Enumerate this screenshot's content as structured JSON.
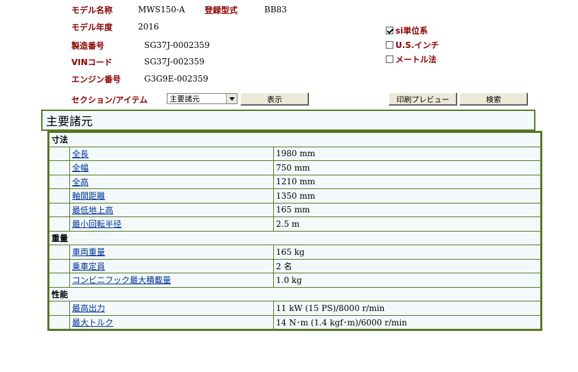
{
  "header": {
    "model_name_label": "モデル名称",
    "model_name_value": "MWS150-A",
    "reg_type_label": "登録型式",
    "reg_type_value": "BB83",
    "model_year_label": "モデル年度",
    "model_year_value": "2016",
    "serial_label": "製造番号",
    "serial_value": "SG37J-0002359",
    "vin_label": "VINコード",
    "vin_value": "SG37J-002359",
    "engine_label": "エンジン番号",
    "engine_value": "G3G9E-002359",
    "section_item_label": "セクション/アイテム"
  },
  "units": {
    "si": {
      "label": "si単位系",
      "checked": true
    },
    "us": {
      "label": "U.S.インチ",
      "checked": false
    },
    "metric": {
      "label": "メートル法",
      "checked": false
    }
  },
  "controls": {
    "section_select_value": "主要諸元",
    "show_button": "表示",
    "print_preview_button": "印刷プレビュー",
    "search_button": "検索"
  },
  "section_title": "主要諸元",
  "groups": [
    {
      "name": "寸法",
      "rows": [
        {
          "name": "全長",
          "value": "1980 mm"
        },
        {
          "name": "全幅",
          "value": "750 mm"
        },
        {
          "name": "全高",
          "value": "1210 mm"
        },
        {
          "name": "軸間距離",
          "value": "1350 mm"
        },
        {
          "name": "最低地上高",
          "value": "165 mm"
        },
        {
          "name": "最小回転半径",
          "value": "2.5 m"
        }
      ]
    },
    {
      "name": "重量",
      "rows": [
        {
          "name": "車両重量",
          "value": "165 kg"
        },
        {
          "name": "乗車定員",
          "value": "2 名"
        },
        {
          "name": "コンビニフック最大積載量",
          "value": "1.0 kg"
        }
      ]
    },
    {
      "name": "性能",
      "rows": [
        {
          "name": "最高出力",
          "value": "11 kW (15 PS)/8000 r/min"
        },
        {
          "name": "最大トルク",
          "value": "14 N･m (1.4 kgf･m)/6000 r/min"
        }
      ]
    }
  ]
}
